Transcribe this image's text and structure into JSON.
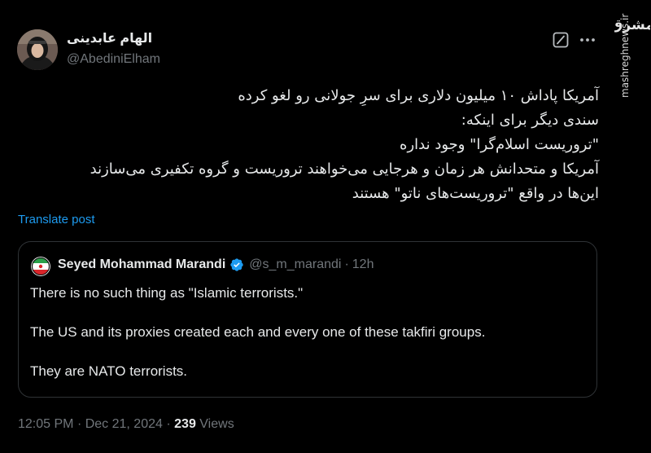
{
  "author": {
    "name": "الهام عابدینی",
    "handle": "@AbediniElham"
  },
  "icons": {
    "grok": "grok-icon",
    "more": "more-icon",
    "verified": "verified-badge-icon"
  },
  "tweet": {
    "lines": [
      "آمریکا پاداش ۱۰ میلیون دلاری برای سرِ جولانی رو لغو کرده",
      "سندی دیگر برای اینکه:",
      "\"تروریست اسلام‌گرا\" وجود نداره",
      "آمریکا و متحدانش هر زمان و هرجایی می‌خواهند تروریست و گروه تکفیری می‌سازند",
      "این‌ها در واقع \"تروریست‌های ناتو\" هستند"
    ],
    "translate_label": "Translate post"
  },
  "quoted": {
    "name": "Seyed Mohammad Marandi",
    "handle": "@s_m_marandi",
    "separator": "·",
    "time": "12h",
    "paragraphs": [
      "There is no such thing as \"Islamic terrorists.\"",
      "The US and its proxies created each and every one of these takfiri groups.",
      "They are NATO terrorists."
    ]
  },
  "meta": {
    "time": "12:05 PM",
    "separator": "·",
    "date": "Dec 21, 2024",
    "separator2": "·",
    "views_count": "239",
    "views_label": "Views"
  },
  "watermark": {
    "logo_text": "مشرق",
    "site": "mashreghnews.ir"
  },
  "colors": {
    "background": "#000000",
    "text": "#e7e9ea",
    "muted": "#71767b",
    "link": "#1d9bf0",
    "border": "#2f3336"
  }
}
